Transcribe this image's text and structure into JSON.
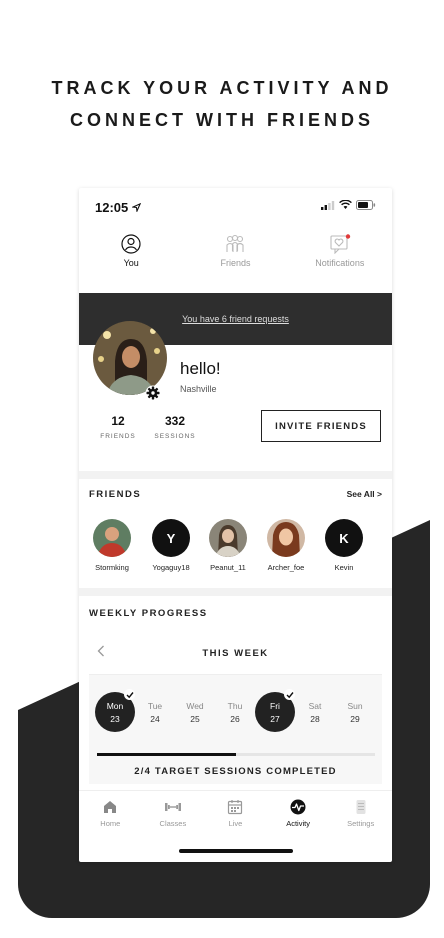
{
  "headline": {
    "line1": "TRACK YOUR ACTIVITY AND",
    "line2": "CONNECT WITH FRIENDS"
  },
  "status_bar": {
    "time": "12:05"
  },
  "top_nav": {
    "tabs": [
      {
        "label": "You",
        "icon": "user-icon",
        "active": true
      },
      {
        "label": "Friends",
        "icon": "friends-icon",
        "active": false
      },
      {
        "label": "Notifications",
        "icon": "notification-icon",
        "active": false
      }
    ]
  },
  "banner": {
    "text": "You have 6 friend requests"
  },
  "profile": {
    "greeting": "hello!",
    "location": "Nashville",
    "friends_count": "12",
    "friends_label": "FRIENDS",
    "sessions_count": "332",
    "sessions_label": "SESSIONS",
    "invite_label": "INVITE FRIENDS"
  },
  "friends": {
    "title": "FRIENDS",
    "see_all": "See All >",
    "items": [
      {
        "name": "Stormking",
        "initial": ""
      },
      {
        "name": "Yogaguy18",
        "initial": "Y"
      },
      {
        "name": "Peanut_11",
        "initial": ""
      },
      {
        "name": "Archer_foe",
        "initial": ""
      },
      {
        "name": "Kevin",
        "initial": "K"
      }
    ]
  },
  "weekly": {
    "title": "WEEKLY PROGRESS",
    "week_label": "THIS WEEK",
    "days": [
      {
        "day": "Mon",
        "date": "23",
        "done": true
      },
      {
        "day": "Tue",
        "date": "24",
        "done": false
      },
      {
        "day": "Wed",
        "date": "25",
        "done": false
      },
      {
        "day": "Thu",
        "date": "26",
        "done": false
      },
      {
        "day": "Fri",
        "date": "27",
        "done": true
      },
      {
        "day": "Sat",
        "date": "28",
        "done": false
      },
      {
        "day": "Sun",
        "date": "29",
        "done": false
      }
    ],
    "progress_fraction": 0.5,
    "target_text": "2/4 TARGET SESSIONS COMPLETED"
  },
  "bottom_nav": {
    "items": [
      {
        "label": "Home",
        "icon": "home-icon",
        "active": false
      },
      {
        "label": "Classes",
        "icon": "dumbbell-icon",
        "active": false
      },
      {
        "label": "Live",
        "icon": "calendar-icon",
        "active": false
      },
      {
        "label": "Activity",
        "icon": "activity-icon",
        "active": true
      },
      {
        "label": "Settings",
        "icon": "settings-icon",
        "active": false
      }
    ]
  },
  "colors": {
    "dark": "#2e2e2e",
    "accent": "#e03a3a",
    "background": "#ffffff"
  }
}
